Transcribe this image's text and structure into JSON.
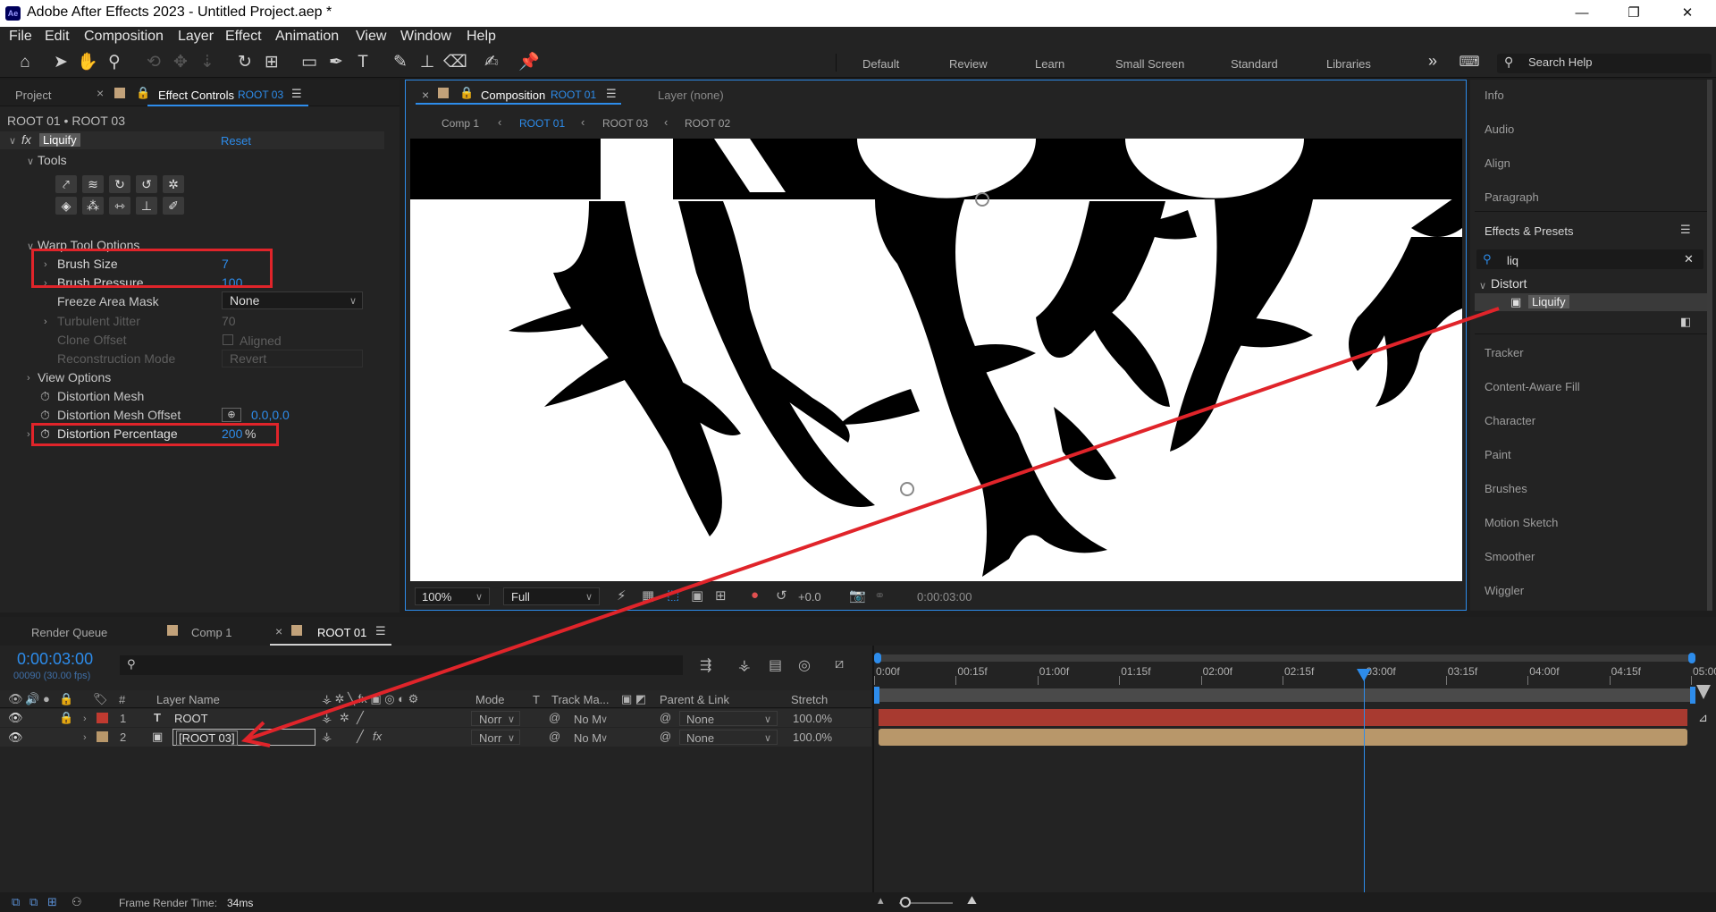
{
  "window": {
    "title": "Adobe After Effects 2023 - Untitled Project.aep *",
    "logo": "Ae",
    "minimize": "—",
    "maximize": "❐",
    "close": "✕"
  },
  "menu": [
    "File",
    "Edit",
    "Composition",
    "Layer",
    "Effect",
    "View",
    "Window",
    "Help"
  ],
  "workspaces": [
    "Default",
    "Review",
    "Learn",
    "Small Screen",
    "Standard",
    "Libraries"
  ],
  "workspaces_more": "»",
  "search_help": {
    "placeholder": "Search Help"
  },
  "left_panel": {
    "tab_project": "Project",
    "tab_effect_controls": "Effect Controls",
    "tab_effect_controls_target": "ROOT 03",
    "breadcrumb": "ROOT 01 • ROOT 03",
    "effect": {
      "fx": "fx",
      "name": "Liquify",
      "reset": "Reset"
    },
    "tools_label": "Tools",
    "warp_tool_options": "Warp Tool Options",
    "props": [
      {
        "label": "Brush Size",
        "value": "7"
      },
      {
        "label": "Brush Pressure",
        "value": "100"
      },
      {
        "label": "Freeze Area Mask",
        "value": "None"
      },
      {
        "label": "Turbulent Jitter",
        "value": "70"
      },
      {
        "label": "Clone Offset",
        "value": "Aligned"
      },
      {
        "label": "Reconstruction Mode",
        "value": "Revert"
      }
    ],
    "view_options": "View Options",
    "distortion_mesh": "Distortion Mesh",
    "distortion_mesh_offset": {
      "label": "Distortion Mesh Offset",
      "value": "0.0,0.0"
    },
    "distortion_percentage": {
      "label": "Distortion Percentage",
      "value": "200",
      "unit": "%"
    }
  },
  "composition": {
    "tab_label": "Composition",
    "tab_target": "ROOT 01",
    "layer_tab": "Layer (none)",
    "nav": [
      "Comp 1",
      "ROOT 01",
      "ROOT 03",
      "ROOT 02"
    ],
    "zoom": "100%",
    "resolution": "Full",
    "exposure": "+0.0",
    "timecode": "0:00:03:00"
  },
  "right_panel": {
    "items_top": [
      "Info",
      "Audio",
      "Align",
      "Paragraph"
    ],
    "effects_presets": "Effects & Presets",
    "search_value": "liq",
    "category": "Distort",
    "result": "Liquify",
    "items_bottom": [
      "Tracker",
      "Content-Aware Fill",
      "Character",
      "Paint",
      "Brushes",
      "Motion Sketch",
      "Smoother",
      "Wiggler"
    ]
  },
  "timeline": {
    "tabs": [
      "Render Queue",
      "Comp 1",
      "ROOT 01"
    ],
    "timecode": "0:00:03:00",
    "frames": "00090 (30.00 fps)",
    "headers": {
      "label": "#",
      "layer_name": "Layer Name",
      "mode": "Mode",
      "t": "T",
      "track_matte": "Track Ma...",
      "parent": "Parent & Link",
      "stretch": "Stretch"
    },
    "layers": [
      {
        "num": "1",
        "name": "ROOT",
        "mode": "Norr",
        "matte": "No M",
        "parent": "None",
        "stretch": "100.0%",
        "color": "#c03a30"
      },
      {
        "num": "2",
        "name": "[ROOT 03]",
        "mode": "Norr",
        "matte": "No M",
        "parent": "None",
        "stretch": "100.0%",
        "color": "#b8976a"
      }
    ],
    "ruler": [
      "0:00f",
      "00:15f",
      "01:00f",
      "01:15f",
      "02:00f",
      "02:15f",
      "03:00f",
      "03:15f",
      "04:00f",
      "04:15f",
      "05:00f"
    ],
    "playhead_seconds": 3.0,
    "frame_render_label": "Frame Render Time:",
    "frame_render_value": "34ms"
  }
}
